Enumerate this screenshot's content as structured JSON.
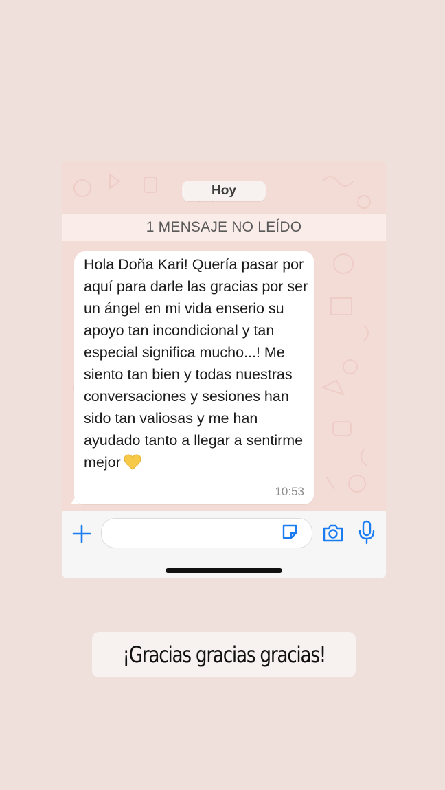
{
  "chat": {
    "date_label": "Hoy",
    "unread_banner": "1 MENSAJE NO LEÍDO",
    "message": {
      "text": "Hola Doña Kari! Quería pasar por aquí para darle las gracias por ser un ángel en mi vida enserio su apoyo tan incondicional y tan especial significa mucho...! Me siento tan bien y todas nuestras conversaciones y sesiones han sido tan valiosas y me han ayudado tanto a llegar a sentirme mejor",
      "emoji": "yellow-heart",
      "time": "10:53"
    }
  },
  "input_bar": {
    "value": "",
    "icons": [
      "plus-icon",
      "sticker-icon",
      "camera-icon",
      "microphone-icon"
    ],
    "accent_color": "#1a7cf2"
  },
  "caption": {
    "text": "¡Gracias gracias gracias!"
  },
  "colors": {
    "background": "#efe0dc",
    "chat_wallpaper": "#f4dcd6",
    "bubble": "#ffffff"
  }
}
